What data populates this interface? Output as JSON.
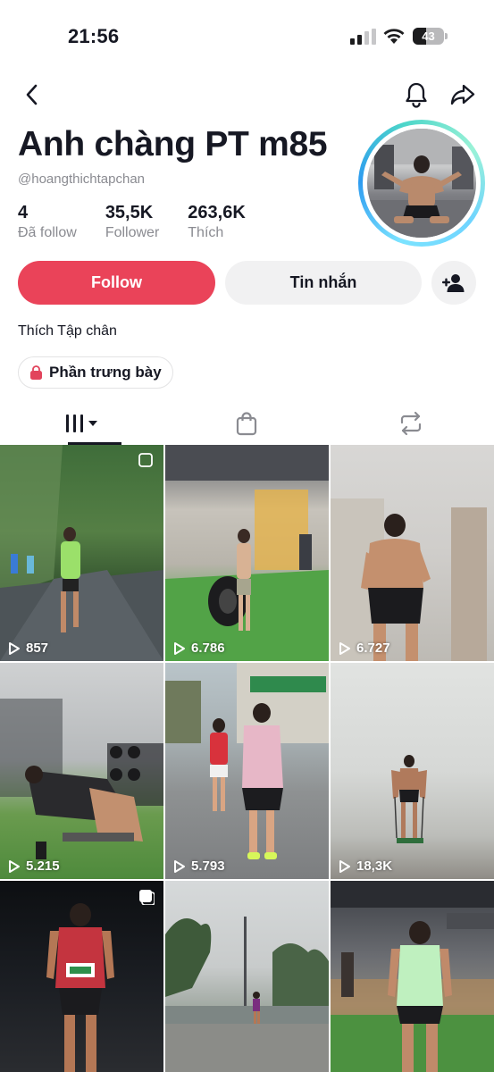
{
  "status_bar": {
    "time": "21:56",
    "battery": "43",
    "battery_level": 0.43
  },
  "header": {
    "back_icon": "chevron-left-icon",
    "bell_icon": "bell-icon",
    "share_icon": "share-arrow-icon"
  },
  "profile": {
    "name": "Anh chàng PT m85",
    "handle": "@hoangthichtapchan",
    "stats": [
      {
        "value": "4",
        "label": "Đã follow"
      },
      {
        "value": "35,5K",
        "label": "Follower"
      },
      {
        "value": "263,6K",
        "label": "Thích"
      }
    ],
    "follow_label": "Follow",
    "message_label": "Tin nhắn",
    "bio": "Thích Tập chân",
    "showcase_label": "Phần trưng bày"
  },
  "tabs": [
    {
      "name": "videos",
      "icon": "grid-icon",
      "active": true
    },
    {
      "name": "shop",
      "icon": "shopping-bag-icon",
      "active": false
    },
    {
      "name": "repost",
      "icon": "repost-icon",
      "active": false
    }
  ],
  "colors": {
    "follow": "#ea4359",
    "secondary_button": "#f1f1f2",
    "text": "#161823",
    "muted": "#8a8b91"
  },
  "videos": [
    {
      "views": "857",
      "scene": "running on forest road",
      "multi": true
    },
    {
      "views": "6.786",
      "scene": "gym with tire",
      "multi": false
    },
    {
      "views": "6.727",
      "scene": "mirror selfie shirtless",
      "multi": false
    },
    {
      "views": "5.215",
      "scene": "gym dumbbell rack",
      "multi": false
    },
    {
      "views": "5.793",
      "scene": "street running pair",
      "multi": false
    },
    {
      "views": "18,3K",
      "scene": "foggy beach pose",
      "multi": false
    },
    {
      "views": "",
      "scene": "night race runner",
      "multi": true
    },
    {
      "views": "",
      "scene": "beach promenade trees",
      "multi": false
    },
    {
      "views": "",
      "scene": "aerobic center gym",
      "multi": false
    }
  ]
}
